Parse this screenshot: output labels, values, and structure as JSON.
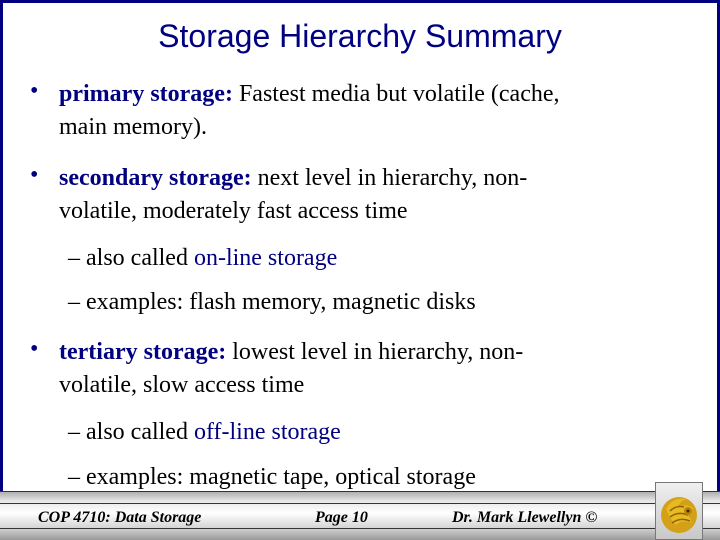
{
  "slide": {
    "title": "Storage Hierarchy Summary",
    "bullets": [
      {
        "term": "primary storage:",
        "line1": "Fastest media but volatile (cache,",
        "line2": "main memory)."
      },
      {
        "term": "secondary storage:",
        "line1": "next level in hierarchy, non-",
        "line2": "volatile, moderately fast access time",
        "subs": [
          {
            "prefix": "– also called ",
            "highlight": "on-line storage"
          },
          {
            "prefix": "– examples: flash memory, magnetic disks",
            "highlight": ""
          }
        ]
      },
      {
        "term": "tertiary storage:",
        "line1": "lowest level in hierarchy, non-",
        "line2": "volatile, slow access time",
        "subs": [
          {
            "prefix": "– also called ",
            "highlight": "off-line storage"
          },
          {
            "prefix": "– examples: magnetic tape, optical storage",
            "highlight": ""
          }
        ]
      }
    ],
    "bullet_glyph": "•"
  },
  "footer": {
    "course": "COP 4710: Data Storage",
    "page": "Page 10",
    "author": "Dr. Mark Llewellyn ©",
    "logo_icon": "ucf-pegasus-logo"
  },
  "colors": {
    "accent": "#000080",
    "logo_gold": "#d4a017"
  }
}
